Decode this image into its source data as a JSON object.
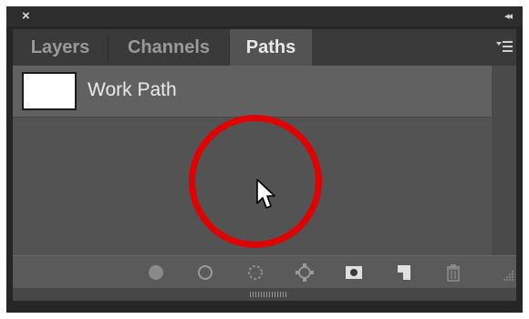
{
  "window": {
    "close_label": "×",
    "collapse_label": "◂◂"
  },
  "tabs": [
    {
      "label": "Layers",
      "active": false
    },
    {
      "label": "Channels",
      "active": false
    },
    {
      "label": "Paths",
      "active": true
    }
  ],
  "paths": [
    {
      "name": "Work Path",
      "thumbnail": "white-rectangle"
    }
  ],
  "toolbar": {
    "icons": [
      "fill-path-icon",
      "stroke-path-icon",
      "load-selection-icon",
      "make-work-path-icon",
      "add-mask-icon",
      "new-path-icon",
      "delete-path-icon"
    ]
  },
  "colors": {
    "highlight_ring": "#e10000",
    "panel_bg": "#535353",
    "selected_row": "#616161"
  }
}
